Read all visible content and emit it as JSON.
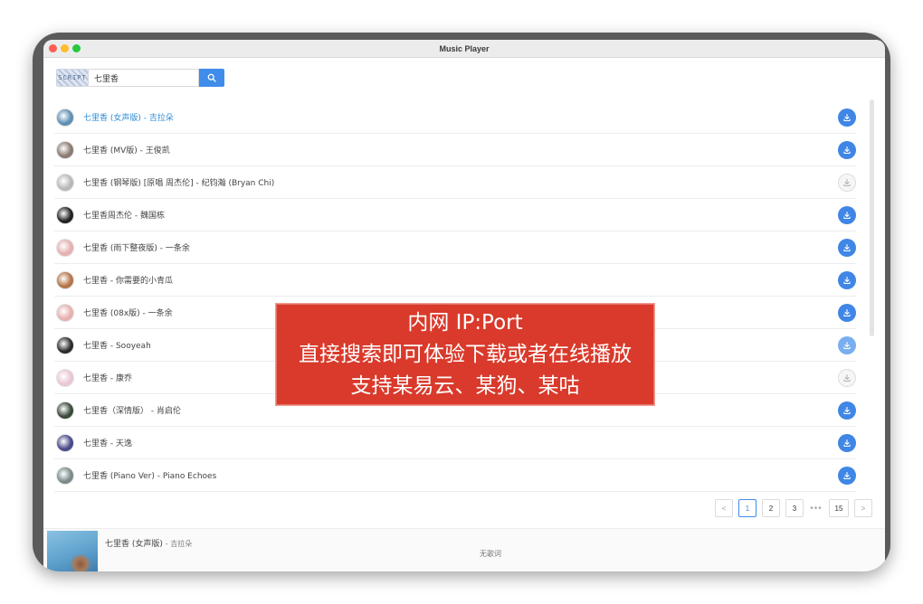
{
  "window": {
    "title": "Music Player"
  },
  "search": {
    "captcha": "SCRIPT",
    "value": "七里香",
    "icon": "search-icon"
  },
  "songs": [
    {
      "title": "七里香 (女声版) - 吉拉朵",
      "avatar_color": "#5f8fb5",
      "download": "enabled",
      "active": true
    },
    {
      "title": "七里香 (MV版) - 王俊凯",
      "avatar_color": "#8a7a70",
      "download": "enabled"
    },
    {
      "title": "七里香 (钢琴版) [原唱 周杰伦] - 纪钧瀚 (Bryan Chi)",
      "avatar_color": "#b8b8b8",
      "download": "disabled"
    },
    {
      "title": "七里香周杰伦 - 魏国栋",
      "avatar_color": "#222222",
      "download": "enabled"
    },
    {
      "title": "七里香 (雨下整夜版) - 一条余",
      "avatar_color": "#e6b0b0",
      "download": "enabled"
    },
    {
      "title": "七里香 - 你需要的小青瓜",
      "avatar_color": "#b5744a",
      "download": "enabled"
    },
    {
      "title": "七里香 (08x版) - 一条余",
      "avatar_color": "#e6b0b0",
      "download": "enabled"
    },
    {
      "title": "七里香 - Sooyeah",
      "avatar_color": "#2c2c2c",
      "download": "light"
    },
    {
      "title": "七里香 - 康乔",
      "avatar_color": "#e9c6d6",
      "download": "disabled"
    },
    {
      "title": "七里香（深情版） - 肖启伦",
      "avatar_color": "#3a4a3a",
      "download": "enabled"
    },
    {
      "title": "七里香 - 天逸",
      "avatar_color": "#4a4a8a",
      "download": "enabled"
    },
    {
      "title": "七里香 (Piano Ver) - Piano Echoes",
      "avatar_color": "#7a8a8a",
      "download": "enabled"
    }
  ],
  "pagination": {
    "prev_label": "<",
    "pages": [
      "1",
      "2",
      "3"
    ],
    "ellipsis": "•••",
    "last": "15",
    "next_label": ">",
    "current": "1"
  },
  "player": {
    "title": "七里香 (女声版)",
    "artist": "- 吉拉朵",
    "lyrics": "无歌词"
  },
  "banner": {
    "line1": "内网 IP:Port",
    "line2": "直接搜索即可体验下载或者在线播放",
    "line3": "支持某易云、某狗、某咕"
  },
  "colors": {
    "accent": "#3f8ceb",
    "banner_red": "#d93a2b",
    "active_text": "#2d8cd6"
  }
}
